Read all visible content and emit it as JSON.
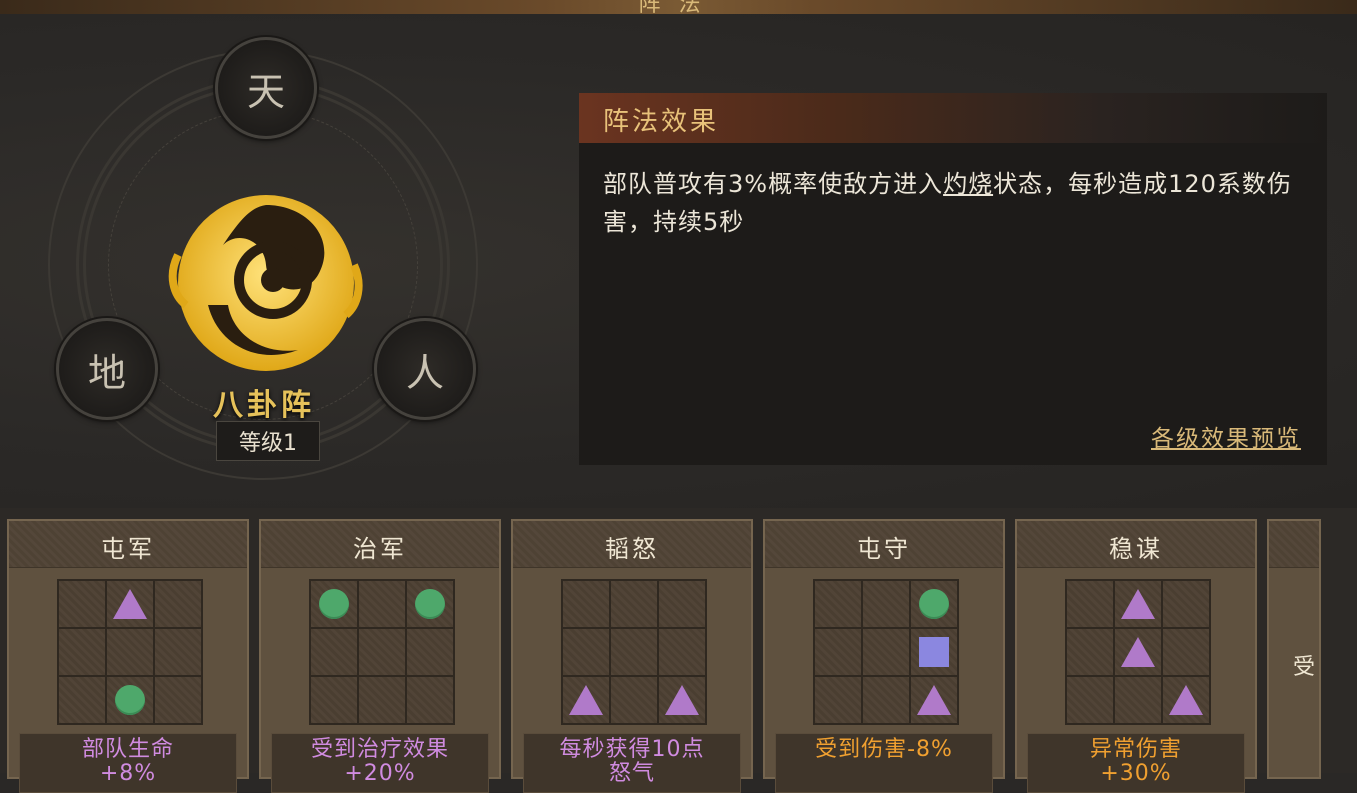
{
  "header": {
    "title": "阵法"
  },
  "formation": {
    "name": "八卦阵",
    "level": "等级1",
    "nodes": {
      "top": "天",
      "left": "地",
      "right": "人"
    }
  },
  "effect": {
    "title": "阵法效果",
    "text_before": "部队普攻有3%概率使敌方进入",
    "keyword": "灼烧",
    "text_after": "状态，每秒造成120系数伤害，持续5秒",
    "preview_link": "各级效果预览"
  },
  "colors": {
    "circle": "#4ea86b",
    "triangle": "#b07ac9",
    "square": "#8b87e0",
    "bonus_purple": "#d08be0",
    "bonus_orange": "#f0a030"
  },
  "cards": [
    {
      "name": "屯军",
      "grid": [
        "",
        "triangle",
        "",
        "",
        "",
        "",
        "",
        "circle",
        ""
      ],
      "bonus": "部队生命\n+8%",
      "bonus_color": "purple"
    },
    {
      "name": "治军",
      "grid": [
        "circle",
        "",
        "circle",
        "",
        "",
        "",
        "",
        "",
        ""
      ],
      "bonus": "受到治疗效果\n+20%",
      "bonus_color": "purple"
    },
    {
      "name": "韬怒",
      "grid": [
        "",
        "",
        "",
        "",
        "",
        "",
        "triangle",
        "",
        "triangle"
      ],
      "bonus": "每秒获得10点\n怒气",
      "bonus_color": "purple"
    },
    {
      "name": "屯守",
      "grid": [
        "",
        "",
        "circle",
        "",
        "",
        "square",
        "",
        "",
        "triangle"
      ],
      "bonus": "受到伤害-8%",
      "bonus_color": "orange"
    },
    {
      "name": "稳谋",
      "grid": [
        "",
        "triangle",
        "",
        "",
        "triangle",
        "",
        "",
        "",
        "triangle"
      ],
      "bonus": "异常伤害\n+30%",
      "bonus_color": "orange"
    }
  ],
  "partial_card": {
    "text": "受"
  }
}
